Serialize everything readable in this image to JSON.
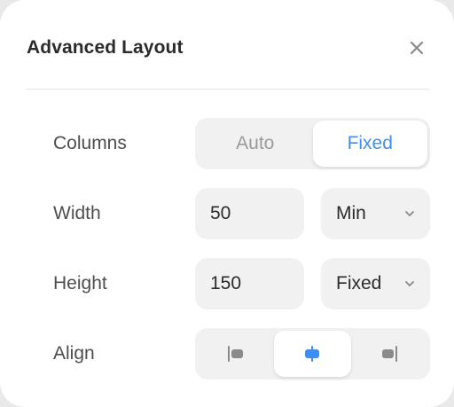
{
  "dialog": {
    "title": "Advanced Layout",
    "close_icon": "close-icon"
  },
  "colors": {
    "accent": "#3d8ef2",
    "label": "#4d4d4d",
    "muted": "#9a9a9a",
    "field_bg": "#f1f1f1"
  },
  "columns": {
    "label": "Columns",
    "options": [
      "Auto",
      "Fixed"
    ],
    "selected": "Fixed"
  },
  "width": {
    "label": "Width",
    "value": "50",
    "mode": "Min"
  },
  "height": {
    "label": "Height",
    "value": "150",
    "mode": "Fixed"
  },
  "align": {
    "label": "Align",
    "options": [
      "align-left-icon",
      "align-center-icon",
      "align-right-icon"
    ],
    "selected": "align-center-icon"
  }
}
